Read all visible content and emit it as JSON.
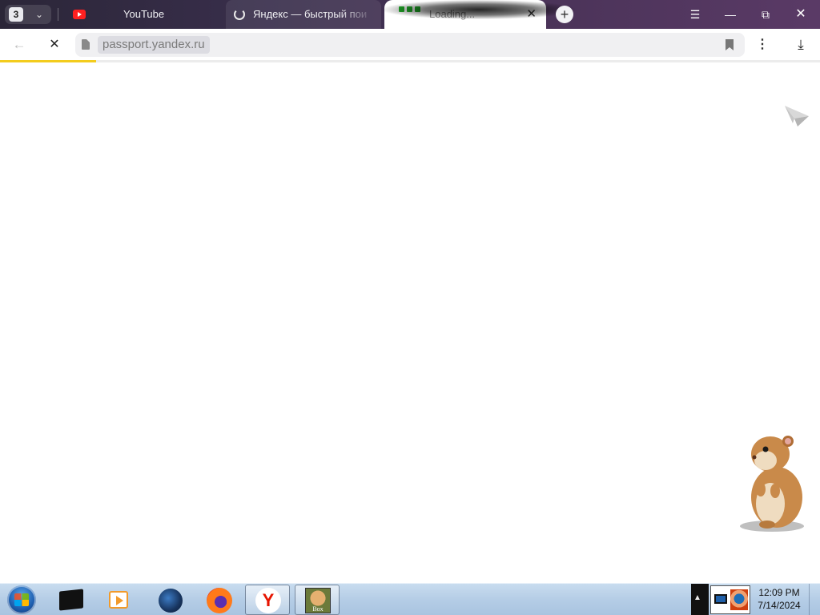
{
  "browser": {
    "tab_count": "3",
    "tabs": [
      {
        "label": "YouTube",
        "favicon": "youtube-icon"
      },
      {
        "label": "Яндекс — быстрый пои",
        "favicon": "loading-spinner-icon"
      },
      {
        "label": "Loading...",
        "favicon": "site-favicon",
        "active": true
      }
    ],
    "address": {
      "url": "passport.yandex.ru"
    },
    "loading_progress": 0.117,
    "accent_color": "#f3cc1d"
  },
  "taskbar": {
    "apps": [
      {
        "name": "terminal-app",
        "icon": "terminal-icon"
      },
      {
        "name": "media-player-app",
        "icon": "play-icon"
      },
      {
        "name": "globe-app",
        "icon": "globe-icon"
      },
      {
        "name": "firefox-app",
        "icon": "firefox-icon"
      },
      {
        "name": "yandex-browser-app",
        "icon": "yandex-icon",
        "letter": "Y"
      },
      {
        "name": "box-app",
        "icon": "box-icon",
        "label": "Box"
      }
    ],
    "clock": {
      "time": "12:09 PM",
      "date": "7/14/2024"
    }
  }
}
